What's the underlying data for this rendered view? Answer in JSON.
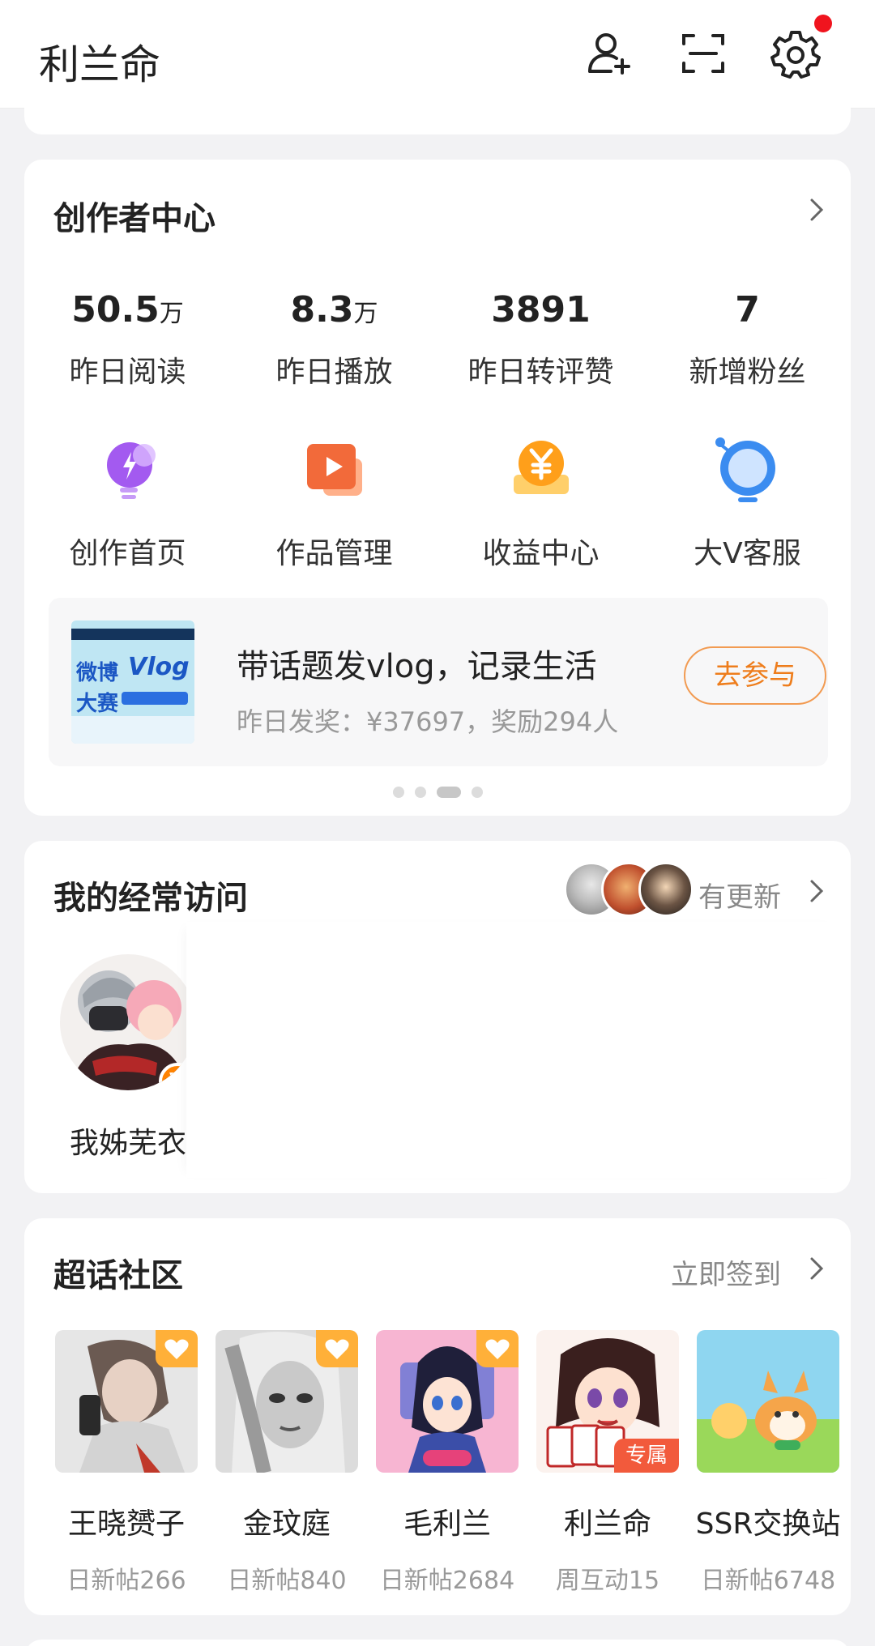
{
  "header": {
    "title": "利兰命",
    "icons": [
      "add-friend-icon",
      "scan-icon",
      "settings-icon"
    ],
    "settings_has_notification": true
  },
  "creator": {
    "title": "创作者中心",
    "stats": [
      {
        "value": "50.5",
        "unit": "万",
        "label": "昨日阅读"
      },
      {
        "value": "8.3",
        "unit": "万",
        "label": "昨日播放"
      },
      {
        "value": "3891",
        "unit": "",
        "label": "昨日转评赞"
      },
      {
        "value": "7",
        "unit": "",
        "label": "新增粉丝"
      }
    ],
    "tools": [
      {
        "label": "创作首页",
        "icon": "creator-bulb-icon"
      },
      {
        "label": "作品管理",
        "icon": "works-play-icon"
      },
      {
        "label": "收益中心",
        "icon": "income-coin-icon"
      },
      {
        "label": "大V客服",
        "icon": "support-headset-icon"
      }
    ],
    "banner": {
      "thumb_text_1": "微博",
      "thumb_text_2": "Vlog",
      "thumb_text_3": "大赛",
      "title": "带话题发vlog，记录生活",
      "subtitle": "昨日发奖：¥37697，奖励294人",
      "button": "去参与"
    },
    "page_dots": {
      "count": 4,
      "active_index": 2
    }
  },
  "visits": {
    "title": "我的经常访问",
    "update_text": "有更新",
    "users": [
      {
        "name": "我姊芜衣",
        "verified": true,
        "badge": "V"
      }
    ]
  },
  "supertopic": {
    "title": "超话社区",
    "action": "立即签到",
    "topics": [
      {
        "name": "王晓赟子",
        "stat": "日新帖266",
        "liked": true,
        "tag": ""
      },
      {
        "name": "金玟庭",
        "stat": "日新帖840",
        "liked": true,
        "tag": ""
      },
      {
        "name": "毛利兰",
        "stat": "日新帖2684",
        "liked": true,
        "tag": ""
      },
      {
        "name": "利兰命",
        "stat": "周互动15",
        "liked": false,
        "tag": "专属"
      },
      {
        "name": "SSR交换站",
        "stat": "日新帖6748",
        "liked": false,
        "tag": ""
      }
    ]
  },
  "colors": {
    "accent_orange": "#ff8200",
    "notification_red": "#f0141e",
    "join_button": "#ee7d1c"
  }
}
